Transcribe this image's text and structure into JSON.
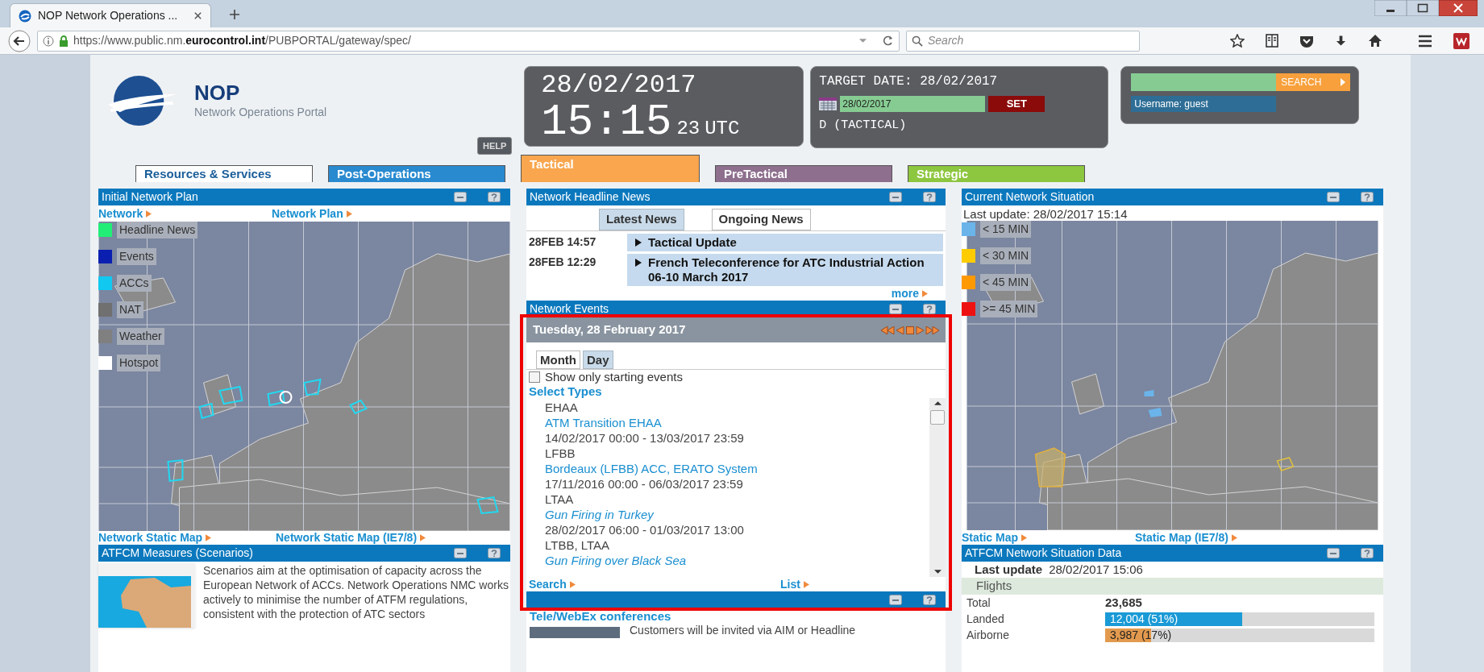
{
  "browser": {
    "tab_title": "NOP Network Operations ...",
    "url": {
      "prefix": "https://www.public.nm.",
      "domain": "eurocontrol.int",
      "path": "/PUBPORTAL/gateway/spec/"
    },
    "search_placeholder": "Search"
  },
  "header": {
    "logo_title": "NOP",
    "logo_subtitle": "Network Operations Portal",
    "help": "HELP",
    "date": "28/02/2017",
    "time": "15:15",
    "seconds": "23",
    "utc": "UTC",
    "target_label": "TARGET DATE: 28/02/2017",
    "target_value": "28/02/2017",
    "set": "SET",
    "mode": "D (TACTICAL)",
    "search_button": "SEARCH",
    "username": "Username: guest"
  },
  "tabs": [
    {
      "label": "Resources & Services",
      "selected": false,
      "color": "#ffffff"
    },
    {
      "label": "Post-Operations",
      "selected": false,
      "color": "#2a8ad0"
    },
    {
      "label": "Tactical",
      "selected": true,
      "color": "#f9a64e"
    },
    {
      "label": "PreTactical",
      "selected": false,
      "color": "#8e6f8e"
    },
    {
      "label": "Strategic",
      "selected": false,
      "color": "#8dc63f"
    }
  ],
  "initial_network_plan": {
    "title": "Initial Network Plan",
    "links": [
      "Network",
      "Network Plan"
    ],
    "legend": [
      {
        "label": "Headline News",
        "color": "#22ee77"
      },
      {
        "label": "Events",
        "color": "#0a1fb0"
      },
      {
        "label": "ACCs",
        "color": "#11c8f0"
      },
      {
        "label": "NAT",
        "color": "#707070"
      },
      {
        "label": "Weather",
        "color": "#808080"
      },
      {
        "label": "Hotspot",
        "color": "#ffffff"
      }
    ],
    "footer_links": [
      "Network Static Map",
      "Network Static Map (IE7/8)"
    ]
  },
  "atfcm_measures": {
    "title": "ATFCM Measures (Scenarios)",
    "text": "Scenarios aim at the optimisation of capacity across the European Network of ACCs. Network Operations NMC works actively to minimise the number of ATFM regulations, consistent with the protection of ATC sectors"
  },
  "headline_news": {
    "title": "Network Headline News",
    "tabs": [
      {
        "label": "Latest News",
        "selected": true
      },
      {
        "label": "Ongoing News",
        "selected": false
      }
    ],
    "items": [
      {
        "time": "28FEB 14:57",
        "title": "Tactical Update"
      },
      {
        "time": "28FEB 12:29",
        "title": "French Teleconference for ATC Industrial Action 06-10 March 2017"
      }
    ],
    "more": "more"
  },
  "network_events": {
    "title": "Network Events",
    "date": "Tuesday, 28 February 2017",
    "view_tabs": [
      {
        "label": "Month",
        "selected": false
      },
      {
        "label": "Day",
        "selected": true
      }
    ],
    "filter": {
      "label": "Show only starting events",
      "checked": false
    },
    "select_types": "Select Types",
    "events": [
      {
        "location": "EHAA",
        "title": "ATM Transition EHAA",
        "italic": false,
        "period": "14/02/2017 00:00 - 13/03/2017 23:59"
      },
      {
        "location": "LFBB",
        "title": "Bordeaux (LFBB) ACC, ERATO System",
        "italic": false,
        "period": "17/11/2016 00:00 - 06/03/2017 23:59"
      },
      {
        "location": "LTAA",
        "title": "Gun Firing in Turkey",
        "italic": true,
        "period": "28/02/2017 06:00 - 01/03/2017 13:00"
      },
      {
        "location": "LTBB, LTAA",
        "title": "Gun Firing over Black Sea",
        "italic": true
      }
    ],
    "links": [
      "Search",
      "List"
    ]
  },
  "teleconferences": {
    "subtitle": "Tele/WebEx conferences",
    "text": "Customers will be invited via AIM or Headline"
  },
  "current_situation": {
    "title": "Current Network Situation",
    "last_update": "Last update: 28/02/2017 15:14",
    "legend": [
      {
        "label": "< 15 MIN",
        "color": "#6ab4ea"
      },
      {
        "label": "< 30 MIN",
        "color": "#ffcc00"
      },
      {
        "label": "< 45 MIN",
        "color": "#ff9900"
      },
      {
        "label": ">= 45 MIN",
        "color": "#ee1111"
      }
    ],
    "footer_links": [
      "Static Map",
      "Static Map (IE7/8)"
    ]
  },
  "situation_data": {
    "title": "ATFCM Network Situation Data",
    "last_update_label": "Last update",
    "last_update_value": "28/02/2017 15:06",
    "section": "Flights",
    "rows": [
      {
        "kind": "number",
        "label": "Total",
        "value": "23,685"
      },
      {
        "kind": "bar",
        "label": "Landed",
        "value": "12,004 (51%)",
        "level": 0.51,
        "color": "#1a9ad6"
      },
      {
        "kind": "bar",
        "label": "Airborne",
        "value": "3,987 (17%)",
        "level": 0.17,
        "color": "#e39a4e"
      }
    ]
  }
}
